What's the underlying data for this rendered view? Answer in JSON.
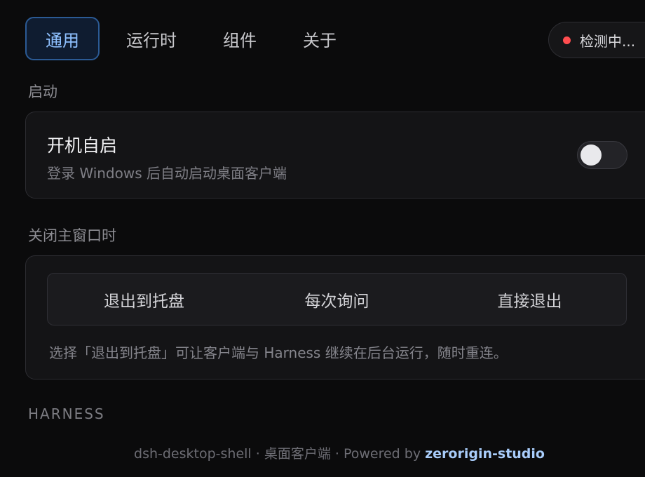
{
  "tabs": [
    {
      "label": "通用",
      "active": true
    },
    {
      "label": "运行时",
      "active": false
    },
    {
      "label": "组件",
      "active": false
    },
    {
      "label": "关于",
      "active": false
    }
  ],
  "status": {
    "label": "检测中...",
    "dot_color": "#ff4d4f"
  },
  "startup_section": {
    "label": "启动",
    "title": "开机自启",
    "description": "登录 Windows 后自动启动桌面客户端",
    "toggle_on": false
  },
  "close_section": {
    "label": "关闭主窗口时",
    "options": [
      "退出到托盘",
      "每次询问",
      "直接退出"
    ],
    "hint": "选择「退出到托盘」可让客户端与 Harness 继续在后台运行，随时重连。"
  },
  "harness_section": {
    "label": "HARNESS"
  },
  "footer": {
    "prefix": "dsh-desktop-shell · 桌面客户端 · Powered by ",
    "link_text": "zerorigin-studio"
  },
  "colors": {
    "accent": "#8fc1ff",
    "background": "#0b0b0c",
    "status_dot": "#ff4d4f"
  }
}
